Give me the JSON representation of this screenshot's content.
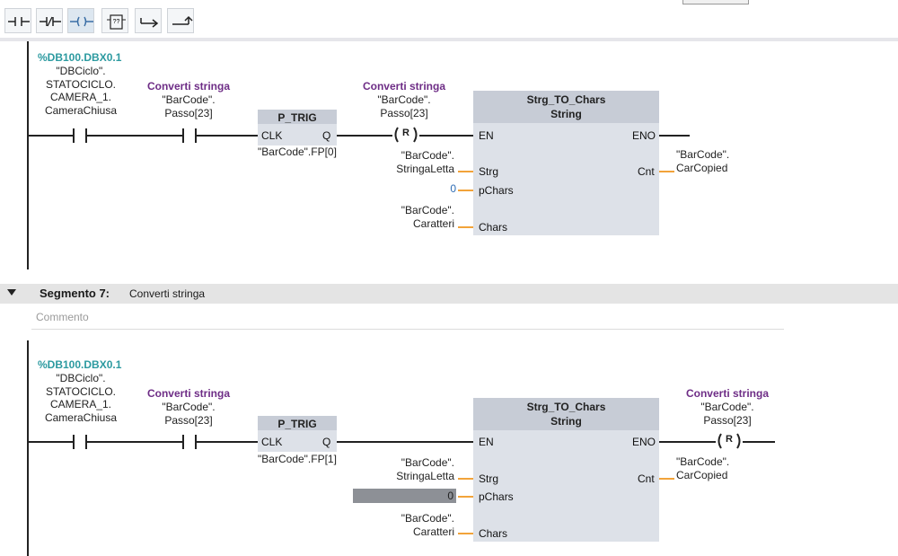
{
  "toolbar": {
    "buttons": [
      {
        "name": "no-contact-icon"
      },
      {
        "name": "nc-contact-icon"
      },
      {
        "name": "coil-icon"
      },
      {
        "name": "empty-box-icon"
      },
      {
        "name": "open-branch-icon"
      },
      {
        "name": "close-branch-icon"
      }
    ]
  },
  "network1": {
    "contact1": {
      "address": "%DB100.DBX0.1",
      "operand": "\"DBCiclo\".\nSTATOCICLO.\nCAMERA_1.\nCameraChiusa"
    },
    "contact2": {
      "comment": "Converti stringa",
      "operand": "\"BarCode\".\nPasso[23]"
    },
    "ptrig": {
      "title": "P_TRIG",
      "clk": "CLK",
      "q": "Q",
      "operand": "\"BarCode\".FP[0]"
    },
    "coil": {
      "comment": "Converti stringa",
      "operand": "\"BarCode\".\nPasso[23]",
      "symbol": "R"
    },
    "block": {
      "title": "Strg_TO_Chars",
      "subtitle": "String",
      "en": "EN",
      "eno": "ENO",
      "strg": "Strg",
      "pchars": "pChars",
      "chars": "Chars",
      "cnt": "Cnt",
      "strg_operand": "\"BarCode\".\nStringaLetta",
      "pchars_value": "0",
      "chars_operand": "\"BarCode\".\nCaratteri",
      "cnt_operand": "\"BarCode\".\nCarCopied"
    }
  },
  "segment": {
    "title": "Segmento 7:",
    "description": "Converti stringa",
    "comment_placeholder": "Commento"
  },
  "network2": {
    "contact1": {
      "address": "%DB100.DBX0.1",
      "operand": "\"DBCiclo\".\nSTATOCICLO.\nCAMERA_1.\nCameraChiusa"
    },
    "contact2": {
      "comment": "Converti stringa",
      "operand": "\"BarCode\".\nPasso[23]"
    },
    "ptrig": {
      "title": "P_TRIG",
      "clk": "CLK",
      "q": "Q",
      "operand": "\"BarCode\".FP[1]"
    },
    "block": {
      "title": "Strg_TO_Chars",
      "subtitle": "String",
      "en": "EN",
      "eno": "ENO",
      "strg": "Strg",
      "pchars": "pChars",
      "chars": "Chars",
      "cnt": "Cnt",
      "strg_operand": "\"BarCode\".\nStringaLetta",
      "pchars_value": "0",
      "chars_operand": "\"BarCode\".\nCaratteri",
      "cnt_operand": "\"BarCode\".\nCarCopied"
    },
    "coil": {
      "comment": "Converti stringa",
      "operand": "\"BarCode\".\nPasso[23]",
      "symbol": "R"
    }
  },
  "colors": {
    "address": "#2c9aa0",
    "comment": "#6e2d86",
    "param_wire": "#f2a33a",
    "block": "#dde1e8"
  }
}
